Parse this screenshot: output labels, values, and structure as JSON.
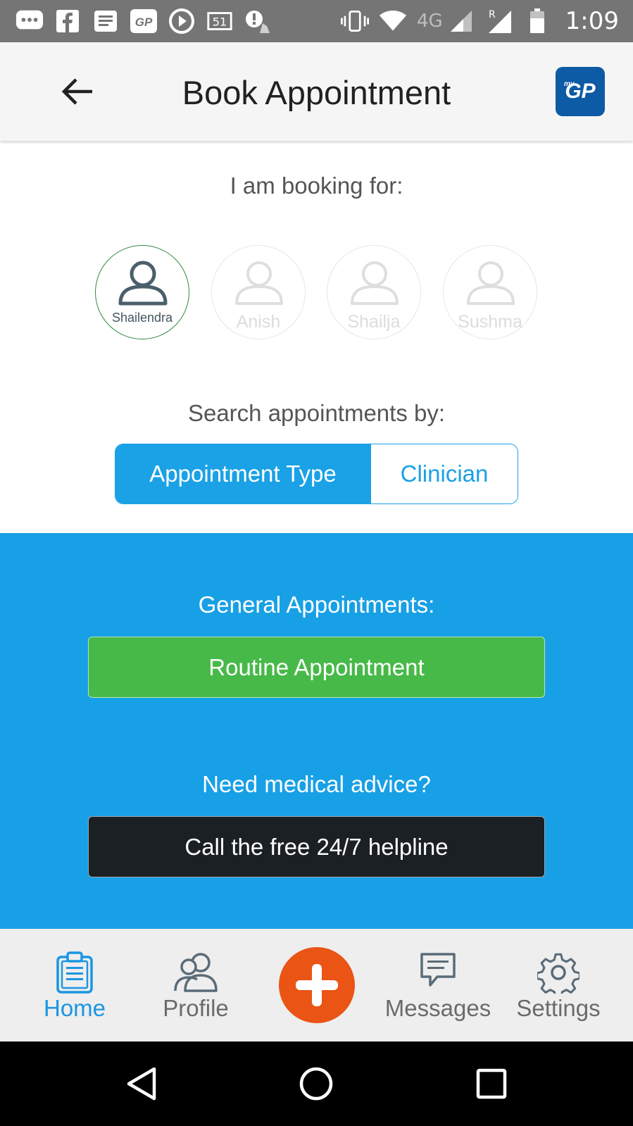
{
  "status_bar": {
    "network_type": "4G",
    "roaming": "R",
    "time": "1:09",
    "notification_icons": [
      "chat-icon",
      "facebook-icon",
      "news-icon",
      "mygp-icon",
      "play-icon",
      "calendar-icon",
      "alert-icon"
    ],
    "calendar_day": "51"
  },
  "app_bar": {
    "title": "Book Appointment",
    "logo_text": "GP",
    "logo_small": "my"
  },
  "booking": {
    "label": "I am booking for:",
    "people": [
      {
        "name": "Shailendra",
        "selected": true
      },
      {
        "name": "Anish",
        "selected": false
      },
      {
        "name": "Shailja",
        "selected": false
      },
      {
        "name": "Sushma",
        "selected": false
      }
    ]
  },
  "search": {
    "label": "Search appointments by:",
    "options": [
      "Appointment Type",
      "Clinician"
    ],
    "selected": "Appointment Type"
  },
  "panel": {
    "general_label": "General Appointments:",
    "routine_button": "Routine Appointment",
    "advice_label": "Need medical advice?",
    "helpline_button": "Call the free 24/7 helpline"
  },
  "bottom_nav": {
    "home": "Home",
    "profile": "Profile",
    "messages": "Messages",
    "settings": "Settings",
    "active": "Home"
  },
  "colors": {
    "accent_blue": "#18a0e6",
    "routine_green": "#47b948",
    "helpline_dark": "#1b2024",
    "fab_orange": "#ea5415",
    "selected_ring": "#2e8b3d"
  }
}
